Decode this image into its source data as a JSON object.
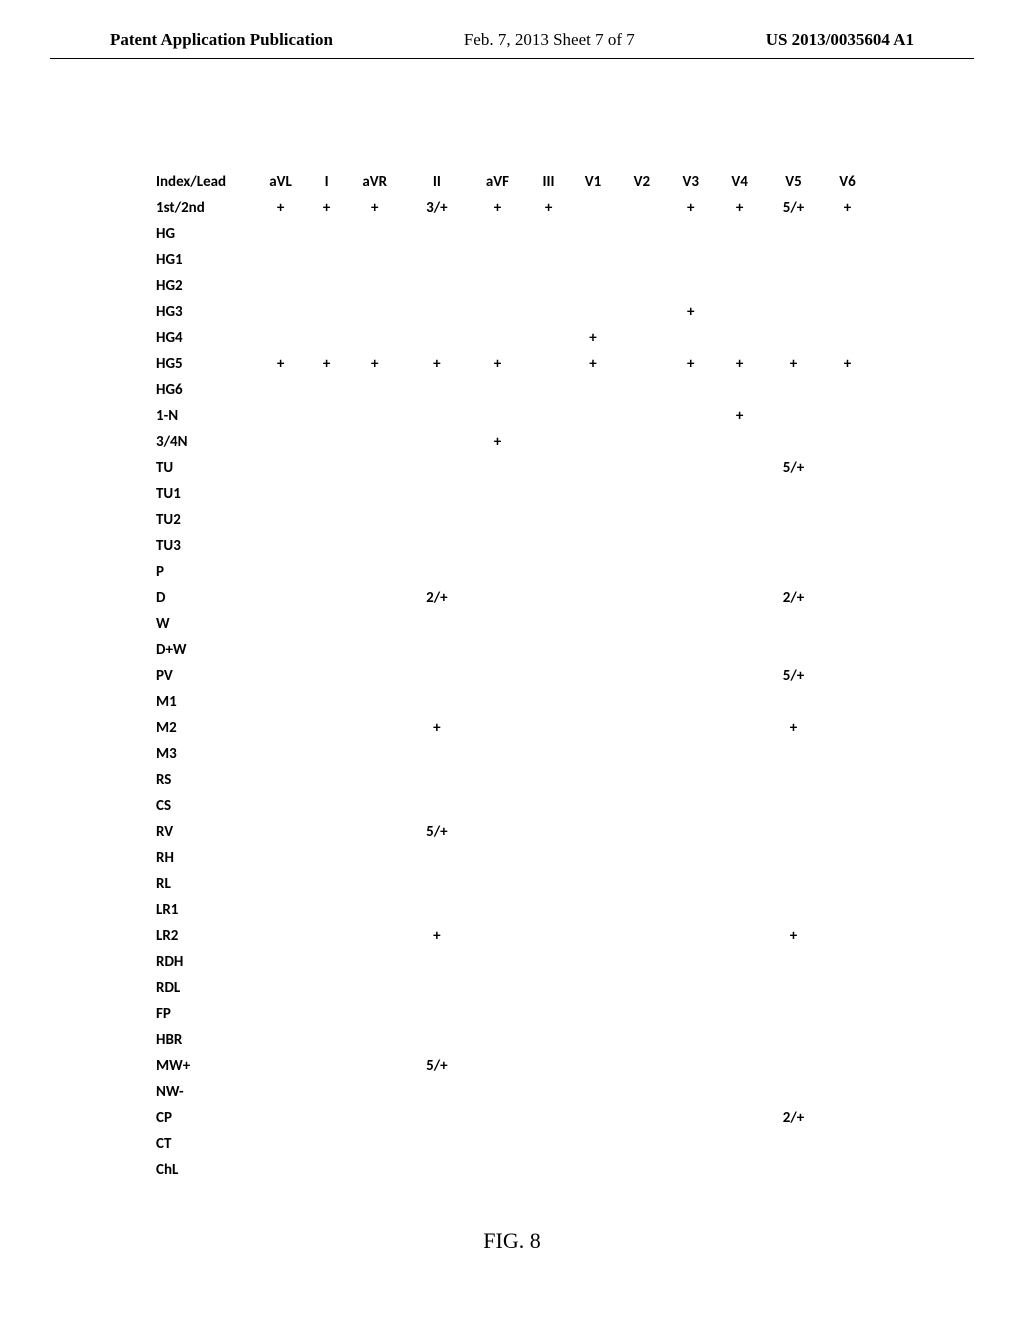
{
  "header": {
    "left": "Patent Application Publication",
    "center": "Feb. 7, 2013  Sheet 7 of 7",
    "right": "US 2013/0035604 A1"
  },
  "figure_label": "FIG. 8",
  "columns": [
    "Index/Lead",
    "aVL",
    "I",
    "aVR",
    "II",
    "aVF",
    "III",
    "V1",
    "V2",
    "V3",
    "V4",
    "V5",
    "V6"
  ],
  "rows": [
    {
      "label": "1st/2nd",
      "cells": [
        "+",
        "+",
        "+",
        "3/+",
        "+",
        "+",
        "",
        "",
        "+",
        "+",
        "5/+",
        "+"
      ]
    },
    {
      "label": "HG",
      "cells": [
        "",
        "",
        "",
        "",
        "",
        "",
        "",
        "",
        "",
        "",
        "",
        ""
      ]
    },
    {
      "label": "HG1",
      "cells": [
        "",
        "",
        "",
        "",
        "",
        "",
        "",
        "",
        "",
        "",
        "",
        ""
      ]
    },
    {
      "label": "HG2",
      "cells": [
        "",
        "",
        "",
        "",
        "",
        "",
        "",
        "",
        "",
        "",
        "",
        ""
      ]
    },
    {
      "label": "HG3",
      "cells": [
        "",
        "",
        "",
        "",
        "",
        "",
        "",
        "",
        "+",
        "",
        "",
        ""
      ]
    },
    {
      "label": "HG4",
      "cells": [
        "",
        "",
        "",
        "",
        "",
        "",
        "+",
        "",
        "",
        "",
        "",
        ""
      ]
    },
    {
      "label": "HG5",
      "cells": [
        "+",
        "+",
        "+",
        "+",
        "+",
        "",
        "+",
        "",
        "+",
        "+",
        "+",
        "+"
      ]
    },
    {
      "label": "HG6",
      "cells": [
        "",
        "",
        "",
        "",
        "",
        "",
        "",
        "",
        "",
        "",
        "",
        ""
      ]
    },
    {
      "label": "1-N",
      "cells": [
        "",
        "",
        "",
        "",
        "",
        "",
        "",
        "",
        "",
        "+",
        "",
        ""
      ]
    },
    {
      "label": "3/4N",
      "cells": [
        "",
        "",
        "",
        "",
        "+",
        "",
        "",
        "",
        "",
        "",
        "",
        ""
      ]
    },
    {
      "label": "TU",
      "cells": [
        "",
        "",
        "",
        "",
        "",
        "",
        "",
        "",
        "",
        "",
        "5/+",
        ""
      ]
    },
    {
      "label": "TU1",
      "cells": [
        "",
        "",
        "",
        "",
        "",
        "",
        "",
        "",
        "",
        "",
        "",
        ""
      ]
    },
    {
      "label": "TU2",
      "cells": [
        "",
        "",
        "",
        "",
        "",
        "",
        "",
        "",
        "",
        "",
        "",
        ""
      ]
    },
    {
      "label": "TU3",
      "cells": [
        "",
        "",
        "",
        "",
        "",
        "",
        "",
        "",
        "",
        "",
        "",
        ""
      ]
    },
    {
      "label": "P",
      "cells": [
        "",
        "",
        "",
        "",
        "",
        "",
        "",
        "",
        "",
        "",
        "",
        ""
      ]
    },
    {
      "label": "D",
      "cells": [
        "",
        "",
        "",
        "2/+",
        "",
        "",
        "",
        "",
        "",
        "",
        "2/+",
        ""
      ]
    },
    {
      "label": "W",
      "cells": [
        "",
        "",
        "",
        "",
        "",
        "",
        "",
        "",
        "",
        "",
        "",
        ""
      ]
    },
    {
      "label": "D+W",
      "cells": [
        "",
        "",
        "",
        "",
        "",
        "",
        "",
        "",
        "",
        "",
        "",
        ""
      ]
    },
    {
      "label": "PV",
      "cells": [
        "",
        "",
        "",
        "",
        "",
        "",
        "",
        "",
        "",
        "",
        "5/+",
        ""
      ]
    },
    {
      "label": "M1",
      "cells": [
        "",
        "",
        "",
        "",
        "",
        "",
        "",
        "",
        "",
        "",
        "",
        ""
      ]
    },
    {
      "label": "M2",
      "cells": [
        "",
        "",
        "",
        "+",
        "",
        "",
        "",
        "",
        "",
        "",
        "+",
        ""
      ]
    },
    {
      "label": "M3",
      "cells": [
        "",
        "",
        "",
        "",
        "",
        "",
        "",
        "",
        "",
        "",
        "",
        ""
      ]
    },
    {
      "label": "RS",
      "cells": [
        "",
        "",
        "",
        "",
        "",
        "",
        "",
        "",
        "",
        "",
        "",
        ""
      ]
    },
    {
      "label": "CS",
      "cells": [
        "",
        "",
        "",
        "",
        "",
        "",
        "",
        "",
        "",
        "",
        "",
        ""
      ]
    },
    {
      "label": "RV",
      "cells": [
        "",
        "",
        "",
        "5/+",
        "",
        "",
        "",
        "",
        "",
        "",
        "",
        ""
      ]
    },
    {
      "label": "RH",
      "cells": [
        "",
        "",
        "",
        "",
        "",
        "",
        "",
        "",
        "",
        "",
        "",
        ""
      ]
    },
    {
      "label": "RL",
      "cells": [
        "",
        "",
        "",
        "",
        "",
        "",
        "",
        "",
        "",
        "",
        "",
        ""
      ]
    },
    {
      "label": "LR1",
      "cells": [
        "",
        "",
        "",
        "",
        "",
        "",
        "",
        "",
        "",
        "",
        "",
        ""
      ]
    },
    {
      "label": "LR2",
      "cells": [
        "",
        "",
        "",
        "+",
        "",
        "",
        "",
        "",
        "",
        "",
        "+",
        ""
      ]
    },
    {
      "label": "RDH",
      "cells": [
        "",
        "",
        "",
        "",
        "",
        "",
        "",
        "",
        "",
        "",
        "",
        ""
      ]
    },
    {
      "label": "RDL",
      "cells": [
        "",
        "",
        "",
        "",
        "",
        "",
        "",
        "",
        "",
        "",
        "",
        ""
      ]
    },
    {
      "label": "FP",
      "cells": [
        "",
        "",
        "",
        "",
        "",
        "",
        "",
        "",
        "",
        "",
        "",
        ""
      ]
    },
    {
      "label": "HBR",
      "cells": [
        "",
        "",
        "",
        "",
        "",
        "",
        "",
        "",
        "",
        "",
        "",
        ""
      ]
    },
    {
      "label": "MW+",
      "cells": [
        "",
        "",
        "",
        "5/+",
        "",
        "",
        "",
        "",
        "",
        "",
        "",
        ""
      ]
    },
    {
      "label": "NW-",
      "cells": [
        "",
        "",
        "",
        "",
        "",
        "",
        "",
        "",
        "",
        "",
        "",
        ""
      ]
    },
    {
      "label": "CP",
      "cells": [
        "",
        "",
        "",
        "",
        "",
        "",
        "",
        "",
        "",
        "",
        "2/+",
        ""
      ]
    },
    {
      "label": "CT",
      "cells": [
        "",
        "",
        "",
        "",
        "",
        "",
        "",
        "",
        "",
        "",
        "",
        ""
      ]
    },
    {
      "label": "ChL",
      "cells": [
        "",
        "",
        "",
        "",
        "",
        "",
        "",
        "",
        "",
        "",
        "",
        ""
      ]
    }
  ]
}
